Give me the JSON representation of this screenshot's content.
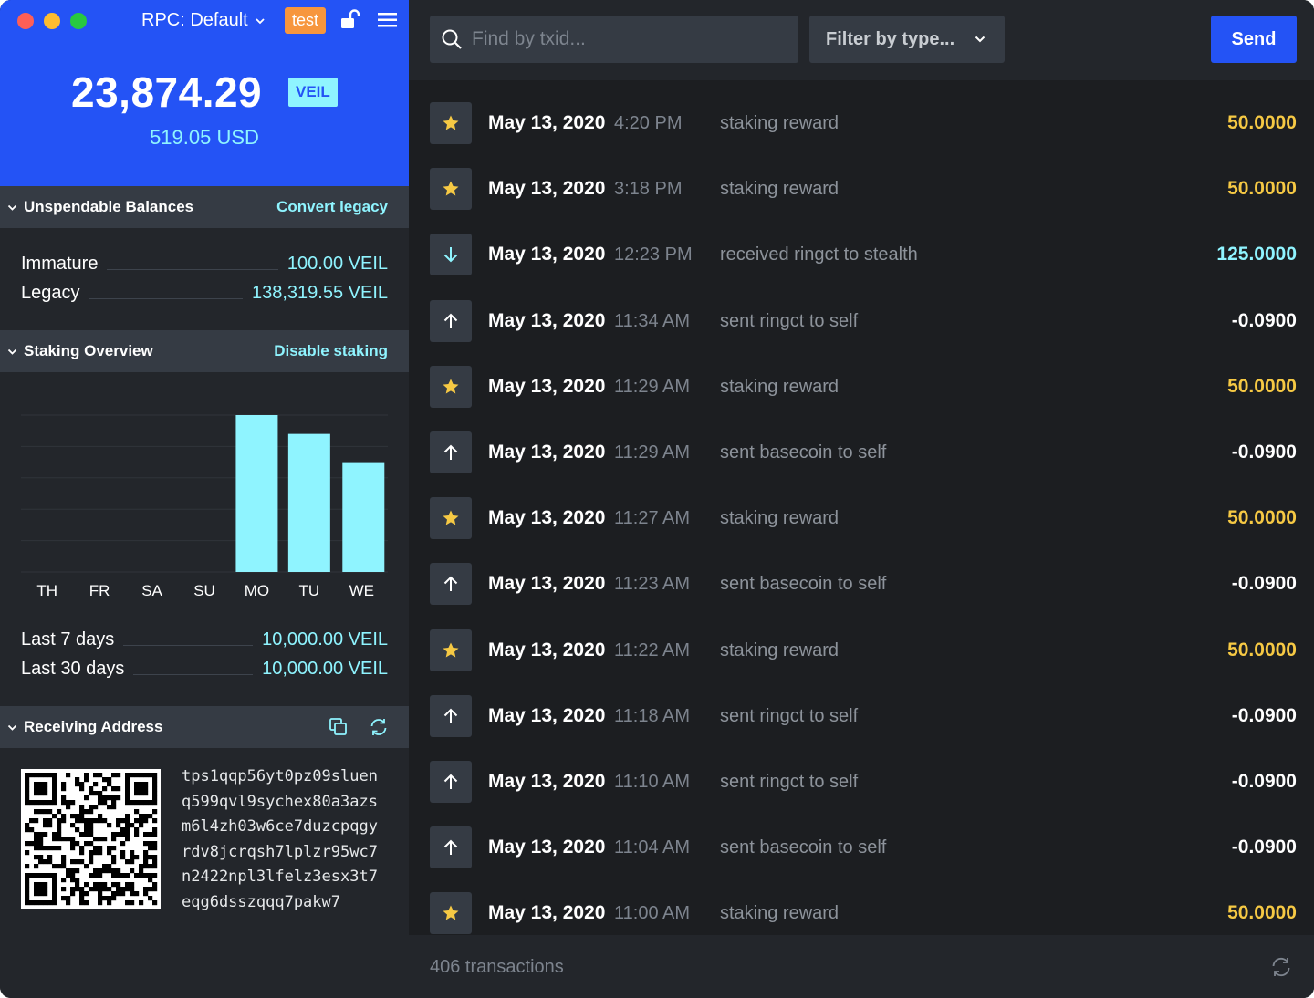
{
  "sidebar": {
    "rpc_label": "RPC: Default",
    "network_badge": "test",
    "balance": "23,874.29",
    "currency_badge": "VEIL",
    "usd_value": "519.05 USD",
    "unspendable": {
      "title": "Unspendable Balances",
      "action": "Convert legacy",
      "rows": [
        {
          "label": "Immature",
          "value": "100.00 VEIL"
        },
        {
          "label": "Legacy",
          "value": "138,319.55 VEIL"
        }
      ]
    },
    "staking": {
      "title": "Staking Overview",
      "action": "Disable staking",
      "rows": [
        {
          "label": "Last 7 days",
          "value": "10,000.00 VEIL"
        },
        {
          "label": "Last 30 days",
          "value": "10,000.00 VEIL"
        }
      ]
    },
    "receiving": {
      "title": "Receiving Address",
      "address_lines": [
        "tps1qqp56yt0pz09sluen",
        "q599qvl9sychex80a3azs",
        "m6l4zh03w6ce7duzcpqgy",
        "rdv8jcrqsh7lplzr95wc7",
        "n2422npl3lfelz3esx3t7",
        "eqg6dsszqqq7pakw7"
      ]
    }
  },
  "chart_data": {
    "type": "bar",
    "categories": [
      "TH",
      "FR",
      "SA",
      "SU",
      "MO",
      "TU",
      "WE"
    ],
    "values": [
      0,
      0,
      0,
      0,
      100,
      88,
      70
    ],
    "color": "#8ff4ff",
    "title": "",
    "xlabel": "",
    "ylabel": "",
    "ylim": [
      0,
      100
    ],
    "grid": true
  },
  "toolbar": {
    "search_placeholder": "Find by txid...",
    "filter_label": "Filter by type...",
    "send_label": "Send"
  },
  "transactions": [
    {
      "type": "stake",
      "date": "May 13, 2020",
      "time": "4:20 PM",
      "desc": "staking reward",
      "amount": "50.0000"
    },
    {
      "type": "stake",
      "date": "May 13, 2020",
      "time": "3:18 PM",
      "desc": "staking reward",
      "amount": "50.0000"
    },
    {
      "type": "receive",
      "date": "May 13, 2020",
      "time": "12:23 PM",
      "desc": "received ringct to stealth",
      "amount": "125.0000"
    },
    {
      "type": "send",
      "date": "May 13, 2020",
      "time": "11:34 AM",
      "desc": "sent ringct to self",
      "amount": "-0.0900"
    },
    {
      "type": "stake",
      "date": "May 13, 2020",
      "time": "11:29 AM",
      "desc": "staking reward",
      "amount": "50.0000"
    },
    {
      "type": "send",
      "date": "May 13, 2020",
      "time": "11:29 AM",
      "desc": "sent basecoin to self",
      "amount": "-0.0900"
    },
    {
      "type": "stake",
      "date": "May 13, 2020",
      "time": "11:27 AM",
      "desc": "staking reward",
      "amount": "50.0000"
    },
    {
      "type": "send",
      "date": "May 13, 2020",
      "time": "11:23 AM",
      "desc": "sent basecoin to self",
      "amount": "-0.0900"
    },
    {
      "type": "stake",
      "date": "May 13, 2020",
      "time": "11:22 AM",
      "desc": "staking reward",
      "amount": "50.0000"
    },
    {
      "type": "send",
      "date": "May 13, 2020",
      "time": "11:18 AM",
      "desc": "sent ringct to self",
      "amount": "-0.0900"
    },
    {
      "type": "send",
      "date": "May 13, 2020",
      "time": "11:10 AM",
      "desc": "sent ringct to self",
      "amount": "-0.0900"
    },
    {
      "type": "send",
      "date": "May 13, 2020",
      "time": "11:04 AM",
      "desc": "sent basecoin to self",
      "amount": "-0.0900"
    },
    {
      "type": "stake",
      "date": "May 13, 2020",
      "time": "11:00 AM",
      "desc": "staking reward",
      "amount": "50.0000"
    }
  ],
  "footer": {
    "count": "406 transactions"
  },
  "colors": {
    "accent_blue": "#2453f5",
    "cyan": "#8ff4ff",
    "stake_gold": "#f6c944",
    "send_white": "#ffffff"
  }
}
